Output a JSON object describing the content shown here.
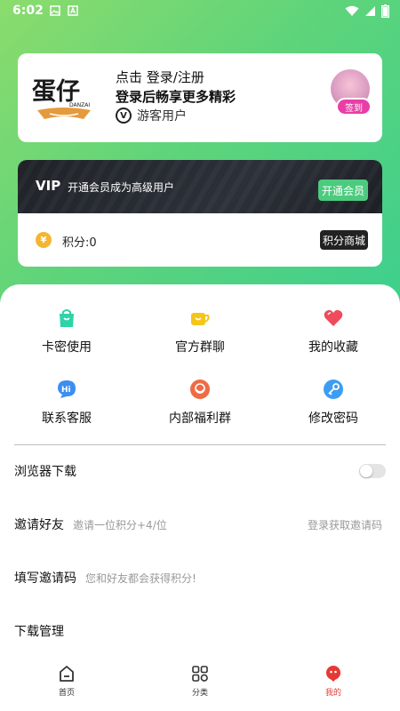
{
  "status_bar": {
    "time": "6:02"
  },
  "login_card": {
    "logo_text": "蛋仔",
    "logo_sub": "DANZAI",
    "line1": "点击 登录/注册",
    "line2": "登录后畅享更多精彩",
    "guest_label": "游客用户",
    "signin_label": "签到"
  },
  "vip_card": {
    "vip_label": "VIP",
    "vip_desc": "开通会员成为高级用户",
    "vip_button": "开通会员",
    "coin_symbol": "¥",
    "points_label": "积分:0",
    "mall_button": "积分商城"
  },
  "grid": [
    {
      "label": "卡密使用",
      "icon": "bag-icon",
      "color": "#2fd3a8"
    },
    {
      "label": "官方群聊",
      "icon": "cup-icon",
      "color": "#f5c518"
    },
    {
      "label": "我的收藏",
      "icon": "heart-icon",
      "color": "#ef4b5c"
    },
    {
      "label": "联系客服",
      "icon": "hi-chat-icon",
      "color": "#3b8ff0"
    },
    {
      "label": "内部福利群",
      "icon": "smile-icon",
      "color": "#ef6b45"
    },
    {
      "label": "修改密码",
      "icon": "key-icon",
      "color": "#3d9df2"
    }
  ],
  "settings": {
    "browser_download": "浏览器下载",
    "invite_friends": "邀请好友",
    "invite_hint": "邀请一位积分+4/位",
    "invite_action": "登录获取邀请码",
    "fill_code": "填写邀请码",
    "fill_hint": "您和好友都会获得积分!",
    "download_manage": "下载管理"
  },
  "tabs": [
    {
      "label": "首页",
      "icon": "home-icon"
    },
    {
      "label": "分类",
      "icon": "category-icon"
    },
    {
      "label": "我的",
      "icon": "profile-icon"
    }
  ],
  "colors": {
    "accent": "#4ccb7f",
    "active_tab": "#e53935",
    "gradient_start": "#8bdc6c",
    "gradient_end": "#3ccf8e"
  }
}
